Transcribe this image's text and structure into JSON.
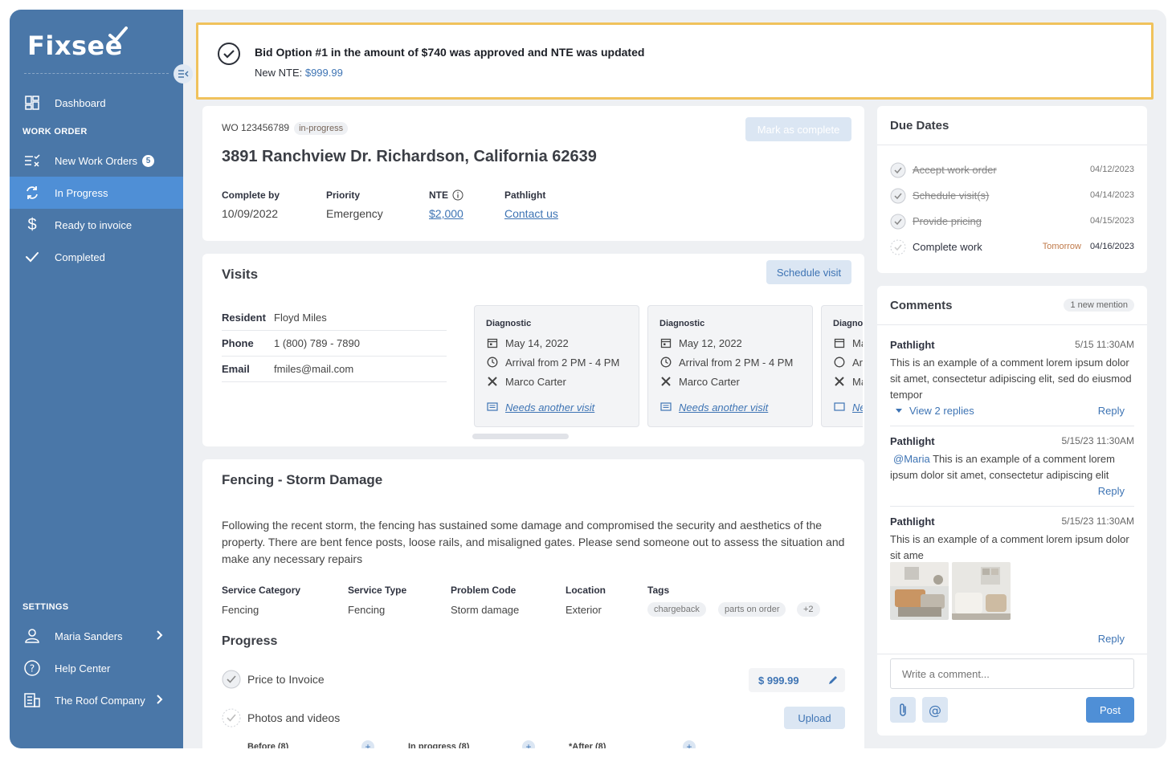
{
  "app": {
    "name": "Fixsee"
  },
  "sidebar": {
    "dashboard": "Dashboard",
    "work_order_label": "WORK ORDER",
    "items": [
      {
        "label": "New Work Orders",
        "badge": "5"
      },
      {
        "label": "In Progress"
      },
      {
        "label": "Ready to invoice"
      },
      {
        "label": "Completed"
      }
    ],
    "settings_label": "SETTINGS",
    "user": "Maria Sanders",
    "help": "Help Center",
    "company": "The Roof Company"
  },
  "banner": {
    "title": "Bid Option #1 in the amount of $740 was approved and NTE was updated",
    "nte_label": "New NTE: ",
    "nte_value": "$999.99"
  },
  "work_order": {
    "id": "WO 123456789",
    "status": "in-progress",
    "mark_complete": "Mark as complete",
    "address": "3891 Ranchview Dr. Richardson, California 62639",
    "complete_by_label": "Complete by",
    "complete_by": "10/09/2022",
    "priority_label": "Priority",
    "priority": "Emergency",
    "nte_label": "NTE",
    "nte": "$2,000",
    "pathlight_label": "Pathlight",
    "pathlight": "Contact us"
  },
  "visits": {
    "title": "Visits",
    "schedule_button": "Schedule visit",
    "resident_label": "Resident",
    "resident": "Floyd Miles",
    "phone_label": "Phone",
    "phone": "1 (800) 789 - 7890",
    "email_label": "Email",
    "email": "fmiles@mail.com",
    "cards": [
      {
        "type": "Diagnostic",
        "date": "May 14, 2022",
        "arrival": "Arrival from 2 PM - 4 PM",
        "tech": "Marco Carter",
        "note": "Needs another visit"
      },
      {
        "type": "Diagnostic",
        "date": "May 12, 2022",
        "arrival": "Arrival from 2 PM - 4 PM",
        "tech": "Marco Carter",
        "note": "Needs another visit"
      },
      {
        "type": "Diagnostic",
        "date": "May",
        "arrival": "Arrival",
        "tech": "Marco",
        "note": "Needs"
      }
    ]
  },
  "issue": {
    "title": "Fencing - Storm Damage",
    "description": "Following the recent storm, the fencing has sustained some damage and compromised the security and aesthetics of the property. There are bent fence posts, loose rails, and misaligned gates.  Please send someone out to assess the situation and make any necessary repairs",
    "service_category_label": "Service Category",
    "service_category": "Fencing",
    "service_type_label": "Service Type",
    "service_type": "Fencing",
    "problem_code_label": "Problem Code",
    "problem_code": "Storm damage",
    "location_label": "Location",
    "location": "Exterior",
    "tags_label": "Tags",
    "tags": [
      "chargeback",
      "parts on order",
      "+2"
    ],
    "progress_title": "Progress",
    "price_label": "Price to Invoice",
    "price_value": "$  999.99",
    "photos_label": "Photos and videos",
    "upload": "Upload",
    "media": [
      "Before (8)",
      "In progress (8)",
      "*After (8)"
    ]
  },
  "due_dates": {
    "title": "Due Dates",
    "items": [
      {
        "label": "Accept work order",
        "date": "04/12/2023",
        "done": true
      },
      {
        "label": "Schedule visit(s)",
        "date": "04/14/2023",
        "done": true
      },
      {
        "label": "Provide pricing",
        "date": "04/15/2023",
        "done": true
      },
      {
        "label": "Complete work",
        "date": "04/16/2023",
        "done": false,
        "note": "Tomorrow"
      }
    ]
  },
  "comments": {
    "title": "Comments",
    "mention": "1 new mention",
    "items": [
      {
        "author": "Pathlight",
        "time": "5/15 11:30AM",
        "text": "This is an example of a comment lorem ipsum dolor sit amet, consectetur adipiscing elit, sed do eiusmod tempor",
        "replies": "View 2 replies",
        "reply": "Reply"
      },
      {
        "author": "Pathlight",
        "time": "5/15/23 11:30AM",
        "mention": "@Maria",
        "text": " This is an example of a comment lorem ipsum dolor sit amet, consectetur adipiscing elit",
        "reply": "Reply"
      },
      {
        "author": "Pathlight",
        "time": "5/15/23 11:30AM",
        "text": "This is an example of a comment lorem ipsum dolor sit ame",
        "reply": "Reply"
      }
    ],
    "placeholder": "Write a comment...",
    "post": "Post"
  },
  "colors": {
    "sidebar": "#4a77a8",
    "active": "#4f8fd6",
    "accent": "#3e74b4",
    "banner_border": "#f0c25c"
  }
}
